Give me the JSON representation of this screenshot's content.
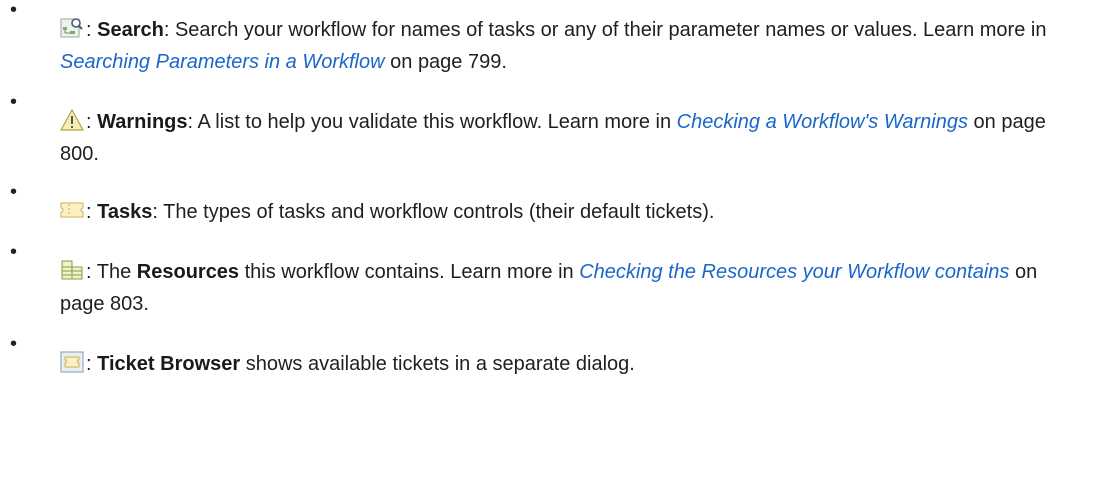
{
  "items": [
    {
      "icon": "search-workflow-icon",
      "pre": ": ",
      "bold": "Search",
      "text1": ": Search your workflow for names of tasks or any of their parameter names or values. Learn more in ",
      "link": "Searching Parameters in a Workflow",
      "text2": " on page 799."
    },
    {
      "icon": "warning-triangle-icon",
      "pre": ": ",
      "bold": "Warnings",
      "text1": ": A list to help you validate this workflow. Learn more in ",
      "link": "Checking a Workflow's Warnings",
      "text2": "  on page 800."
    },
    {
      "icon": "ticket-icon",
      "pre": ": ",
      "bold": "Tasks",
      "text1": ": The types of tasks and workflow controls (their default tickets).",
      "link": "",
      "text2": ""
    },
    {
      "icon": "resources-icon",
      "pre": ": The ",
      "bold": "Resources",
      "text1": " this workflow contains. Learn more in ",
      "link": "Checking the Resources your Workflow contains",
      "text2": " on page 803."
    },
    {
      "icon": "ticket-browser-icon",
      "pre": ": ",
      "bold": "Ticket Browser",
      "text1": " shows available tickets in a separate dialog.",
      "link": "",
      "text2": ""
    }
  ],
  "bullet": "•"
}
